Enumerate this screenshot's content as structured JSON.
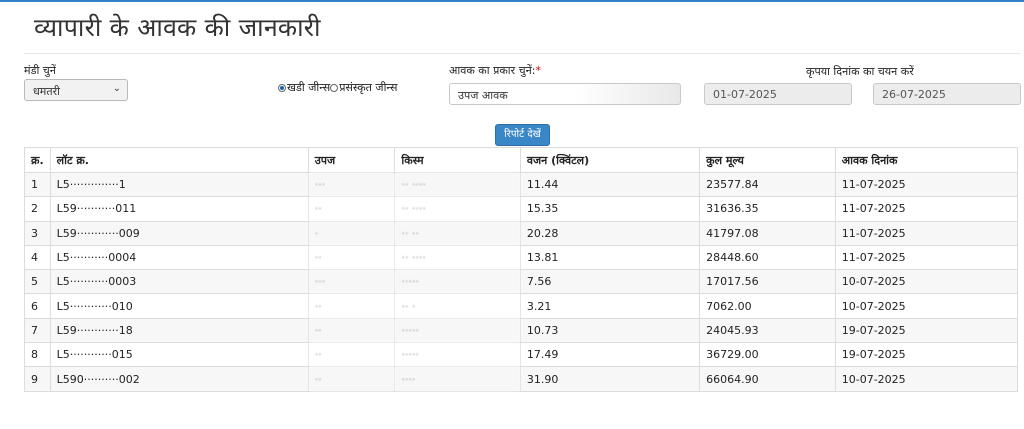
{
  "page": {
    "title": "व्यापारी के आवक की जानकारी"
  },
  "filters": {
    "mandi_label": "मंडी चुनें",
    "mandi_value": "धमतरी",
    "radio_options": [
      "खडी जीन्स",
      "प्रसंस्कृत जीन्स"
    ],
    "radio_selected": 0,
    "arrival_type_label": "आवक का प्रकार चुनें:",
    "arrival_type_required": "*",
    "arrival_type_value": "उपज आवक",
    "date_label": "कृपया दिनांक का चयन करें",
    "date_from": "01-07-2025",
    "date_to": "26-07-2025",
    "report_button": "रिपोर्ट देखें"
  },
  "table": {
    "headers": [
      "क्र.",
      "लॉट क्र.",
      "उपज",
      "किस्म",
      "वजन (क्विंटल)",
      "कुल मूल्य",
      "आवक दिनांक"
    ],
    "rows": [
      [
        "1",
        "L5··············1",
        "···",
        "·· ····",
        "11.44",
        "23577.84",
        "11-07-2025"
      ],
      [
        "2",
        "L59···········011",
        "··",
        "·· ····",
        "15.35",
        "31636.35",
        "11-07-2025"
      ],
      [
        "3",
        "L59············009",
        "·",
        "·· ··",
        "20.28",
        "41797.08",
        "11-07-2025"
      ],
      [
        "4",
        "L5···········0004",
        "··",
        "·· ····",
        "13.81",
        "28448.60",
        "11-07-2025"
      ],
      [
        "5",
        "L5···········0003",
        "···",
        "·····",
        "7.56",
        "17017.56",
        "10-07-2025"
      ],
      [
        "6",
        "L5············010",
        "··",
        "·· ·",
        "3.21",
        "7062.00",
        "10-07-2025"
      ],
      [
        "7",
        "L59············18",
        "··",
        "·····",
        "10.73",
        "24045.93",
        "19-07-2025"
      ],
      [
        "8",
        "L5············015",
        "··",
        "·····",
        "17.49",
        "36729.00",
        "19-07-2025"
      ],
      [
        "9",
        "L590··········002",
        "··",
        "····",
        "31.90",
        "66064.90",
        "10-07-2025"
      ]
    ]
  }
}
